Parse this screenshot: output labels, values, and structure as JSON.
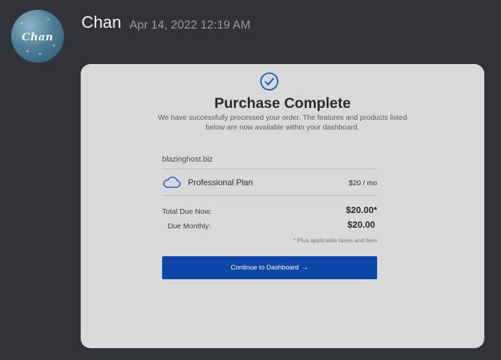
{
  "message": {
    "author": "Chan",
    "timestamp": "Apr 14, 2022 12:19 AM",
    "avatar_text": "Chan"
  },
  "embed": {
    "title": "Purchase Complete",
    "subtitle": "We have successfully processed your order. The features and products listed below are now available within your dashboard.",
    "domain": "blazinghost.biz",
    "plan": {
      "icon": "cloud-icon",
      "name": "Professional Plan",
      "price": "$20 / mo"
    },
    "totals": {
      "total_due_label": "Total Due Now:",
      "total_due_value": "$20.00*",
      "monthly_label": "Due Monthly:",
      "monthly_value": "$20.00"
    },
    "taxes_note": "* Plus applicable taxes and fees",
    "button_label": "Continue to Dashboard",
    "button_icon": "arrow-right-icon"
  },
  "colors": {
    "background": "#313338",
    "card": "#d9d9d9",
    "accent": "#1565c0",
    "button": "#0d47a8"
  }
}
